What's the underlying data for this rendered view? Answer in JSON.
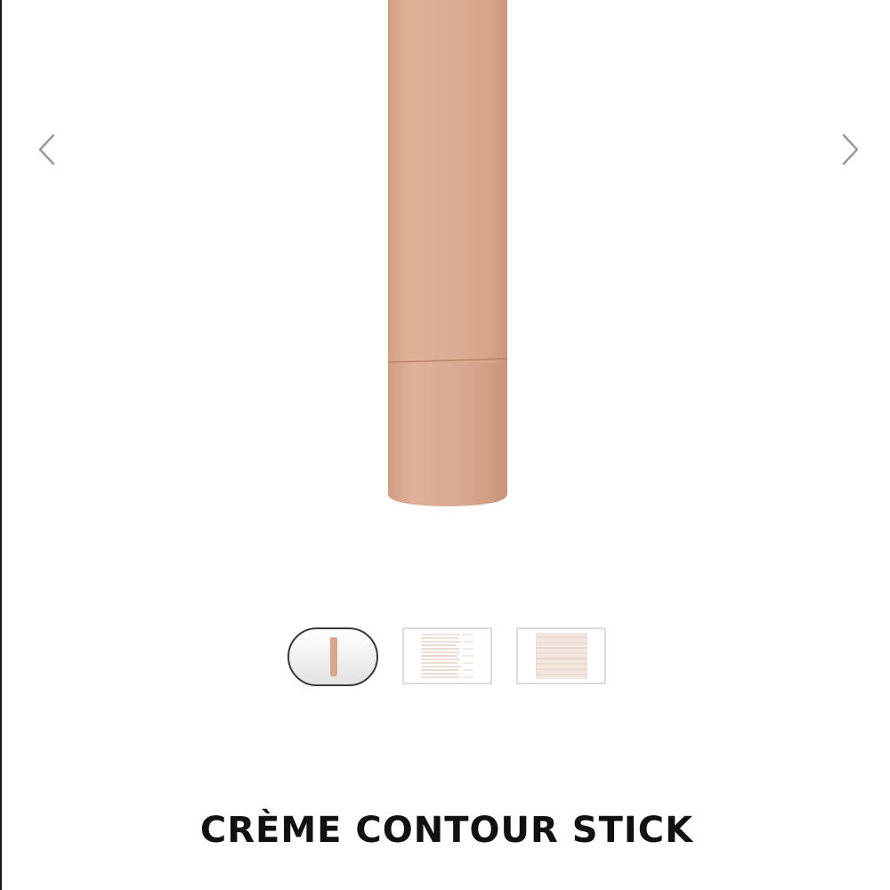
{
  "product": {
    "title": "CRÈME CONTOUR STICK",
    "stick_color": "#dfae94",
    "stick_shade_color": "#d29f85"
  },
  "gallery": {
    "prev_icon": "chevron-left-icon",
    "next_icon": "chevron-right-icon",
    "thumbnails": [
      {
        "name": "product-stick",
        "selected": true
      },
      {
        "name": "swatches-lines",
        "selected": false
      },
      {
        "name": "swatches-blend",
        "selected": false
      }
    ]
  },
  "colors": {
    "arrow": "#9a9a9a",
    "selected_border": "#3a3a3a",
    "thumb_border": "#dcdcdc",
    "title": "#111111"
  }
}
